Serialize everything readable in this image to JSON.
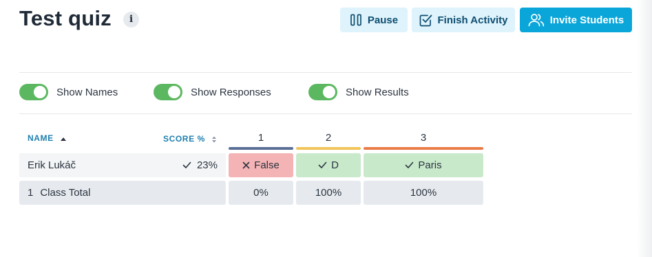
{
  "header": {
    "title": "Test quiz",
    "info_icon": "i"
  },
  "actions": {
    "pause_label": "Pause",
    "finish_label": "Finish Activity",
    "invite_label": "Invite Students"
  },
  "toggles": [
    {
      "label": "Show Names",
      "on": true
    },
    {
      "label": "Show Responses",
      "on": true
    },
    {
      "label": "Show Results",
      "on": true
    }
  ],
  "table": {
    "name_header": "NAME",
    "score_header": "SCORE %",
    "questions": [
      {
        "number": "1",
        "color": "#5a6f96"
      },
      {
        "number": "2",
        "color": "#f2c55a"
      },
      {
        "number": "3",
        "color": "#ea7c4a"
      }
    ],
    "rows": [
      {
        "name": "Erik Lukáč",
        "score": "23%",
        "answers": [
          {
            "text": "False",
            "correct": false
          },
          {
            "text": "D",
            "correct": true
          },
          {
            "text": "Paris",
            "correct": true
          }
        ]
      }
    ],
    "total": {
      "count": "1",
      "label": "Class Total",
      "values": [
        "0%",
        "100%",
        "100%"
      ]
    }
  },
  "colors": {
    "accent": "#0aa6d9",
    "toggle_on": "#5cb860",
    "correct_bg": "#c9e9cb",
    "wrong_bg": "#f4b3b4"
  }
}
